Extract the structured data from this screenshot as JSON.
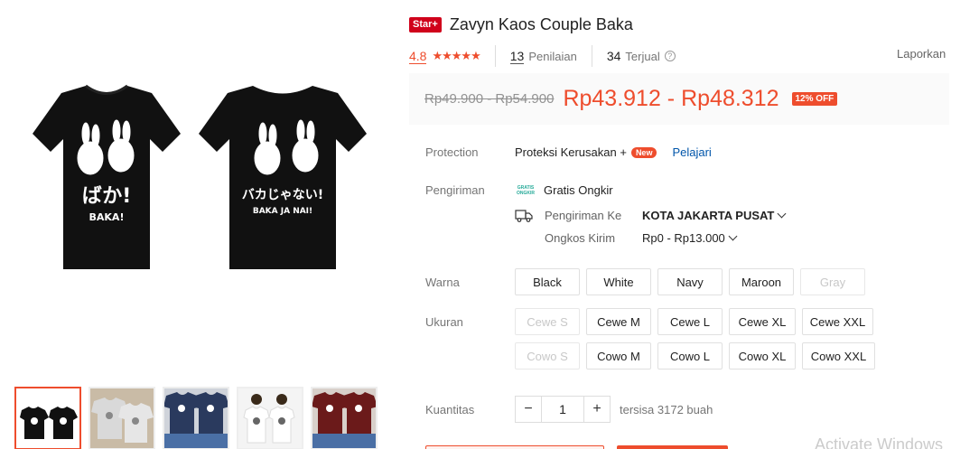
{
  "product": {
    "badge": "Star+",
    "title": "Zavyn Kaos Couple Baka",
    "rating": "4.8",
    "stars": "★★★★★",
    "reviews_count": "13",
    "reviews_label": "Penilaian",
    "sold_count": "34",
    "sold_label": "Terjual",
    "report_label": "Laporkan"
  },
  "price": {
    "original": "Rp49.900 - Rp54.900",
    "current": "Rp43.912 - Rp48.312",
    "discount": "12% OFF"
  },
  "protection": {
    "label": "Protection",
    "value": "Proteksi Kerusakan +",
    "new_badge": "New",
    "learn": "Pelajari"
  },
  "shipping": {
    "label": "Pengiriman",
    "free_logo_line1": "GRATIS",
    "free_logo_line2": "ONGKIR",
    "free_text": "Gratis Ongkir",
    "to_label": "Pengiriman Ke",
    "to_value": "KOTA JAKARTA PUSAT",
    "cost_label": "Ongkos Kirim",
    "cost_value": "Rp0 - Rp13.000"
  },
  "variations": {
    "color_label": "Warna",
    "colors": [
      {
        "label": "Black",
        "enabled": true
      },
      {
        "label": "White",
        "enabled": true
      },
      {
        "label": "Navy",
        "enabled": true
      },
      {
        "label": "Maroon",
        "enabled": true
      },
      {
        "label": "Gray",
        "enabled": false
      }
    ],
    "size_label": "Ukuran",
    "sizes_row1": [
      {
        "label": "Cewe S",
        "enabled": false
      },
      {
        "label": "Cewe M",
        "enabled": true
      },
      {
        "label": "Cewe L",
        "enabled": true
      },
      {
        "label": "Cewe XL",
        "enabled": true
      },
      {
        "label": "Cewe XXL",
        "enabled": true
      }
    ],
    "sizes_row2": [
      {
        "label": "Cowo S",
        "enabled": false
      },
      {
        "label": "Cowo M",
        "enabled": true
      },
      {
        "label": "Cowo L",
        "enabled": true
      },
      {
        "label": "Cowo XL",
        "enabled": true
      },
      {
        "label": "Cowo XXL",
        "enabled": true
      }
    ]
  },
  "quantity": {
    "label": "Kuantitas",
    "minus": "−",
    "value": "1",
    "plus": "+",
    "stock": "tersisa 3172 buah"
  },
  "shirt_text": {
    "left_jp": "ばか!",
    "left_en": "BAKA!",
    "right_jp": "バカじゃない!",
    "right_en": "BAKA JA NAI!"
  },
  "watermark": "Activate Windows",
  "colors": {
    "accent": "#ee4d2d",
    "link": "#0055aa",
    "shirt_black": "#111111",
    "shirt_navy": "#2a3a5e",
    "shirt_maroon": "#6b1a1a",
    "shirt_gray": "#cfcfcf"
  }
}
